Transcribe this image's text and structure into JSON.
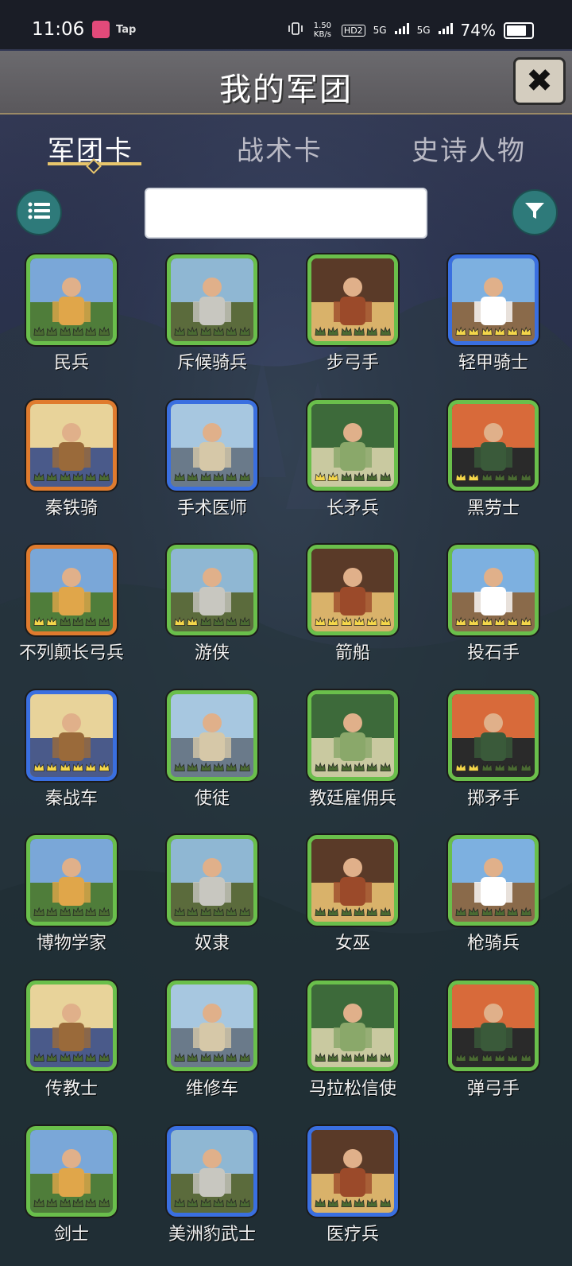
{
  "status_bar": {
    "time": "11:06",
    "app_label": "Tap",
    "net_speed": "1.50 KB/s",
    "hd": "HD2",
    "sig1": "5G",
    "sig2": "5G",
    "battery_pct": "74%"
  },
  "header": {
    "title": "我的军团",
    "close_icon": "close-icon"
  },
  "tabs": [
    {
      "label": "军团卡",
      "active": true
    },
    {
      "label": "战术卡",
      "active": false
    },
    {
      "label": "史诗人物",
      "active": false
    }
  ],
  "toolbar": {
    "search_placeholder": "",
    "list_icon": "list-icon",
    "filter_icon": "filter-icon"
  },
  "cards": [
    {
      "name": "民兵",
      "rarity": "green",
      "crowns": "none"
    },
    {
      "name": "斥候骑兵",
      "rarity": "green",
      "crowns": "none"
    },
    {
      "name": "步弓手",
      "rarity": "green",
      "crowns": "none"
    },
    {
      "name": "轻甲骑士",
      "rarity": "blue",
      "crowns": "gold"
    },
    {
      "name": "秦铁骑",
      "rarity": "orange",
      "crowns": "none"
    },
    {
      "name": "手术医师",
      "rarity": "blue",
      "crowns": "none"
    },
    {
      "name": "长矛兵",
      "rarity": "green",
      "crowns": "gold-partial"
    },
    {
      "name": "黑劳士",
      "rarity": "green",
      "crowns": "gold-partial"
    },
    {
      "name": "不列颠长弓兵",
      "rarity": "orange",
      "crowns": "gold-partial"
    },
    {
      "name": "游侠",
      "rarity": "green",
      "crowns": "gold-partial"
    },
    {
      "name": "箭船",
      "rarity": "green",
      "crowns": "gold"
    },
    {
      "name": "投石手",
      "rarity": "green",
      "crowns": "gold"
    },
    {
      "name": "秦战车",
      "rarity": "blue",
      "crowns": "gold"
    },
    {
      "name": "使徒",
      "rarity": "green",
      "crowns": "none"
    },
    {
      "name": "教廷雇佣兵",
      "rarity": "green",
      "crowns": "none"
    },
    {
      "name": "掷矛手",
      "rarity": "green",
      "crowns": "gold-partial"
    },
    {
      "name": "博物学家",
      "rarity": "green",
      "crowns": "none"
    },
    {
      "name": "奴隶",
      "rarity": "green",
      "crowns": "none"
    },
    {
      "name": "女巫",
      "rarity": "green",
      "crowns": "none"
    },
    {
      "name": "枪骑兵",
      "rarity": "green",
      "crowns": "none"
    },
    {
      "name": "传教士",
      "rarity": "green",
      "crowns": "none"
    },
    {
      "name": "维修车",
      "rarity": "green",
      "crowns": "none"
    },
    {
      "name": "马拉松信使",
      "rarity": "green",
      "crowns": "none"
    },
    {
      "name": "弹弓手",
      "rarity": "green",
      "crowns": "none"
    },
    {
      "name": "剑士",
      "rarity": "green",
      "crowns": "none"
    },
    {
      "name": "美洲豹武士",
      "rarity": "blue",
      "crowns": "none"
    },
    {
      "name": "医疗兵",
      "rarity": "blue",
      "crowns": "none"
    }
  ],
  "colors": {
    "green_frame": "#6abf4b",
    "blue_frame": "#3a6fe0",
    "orange_frame": "#e07b2e",
    "accent_gold": "#e8c66c",
    "button_teal": "#2e7a7a"
  }
}
